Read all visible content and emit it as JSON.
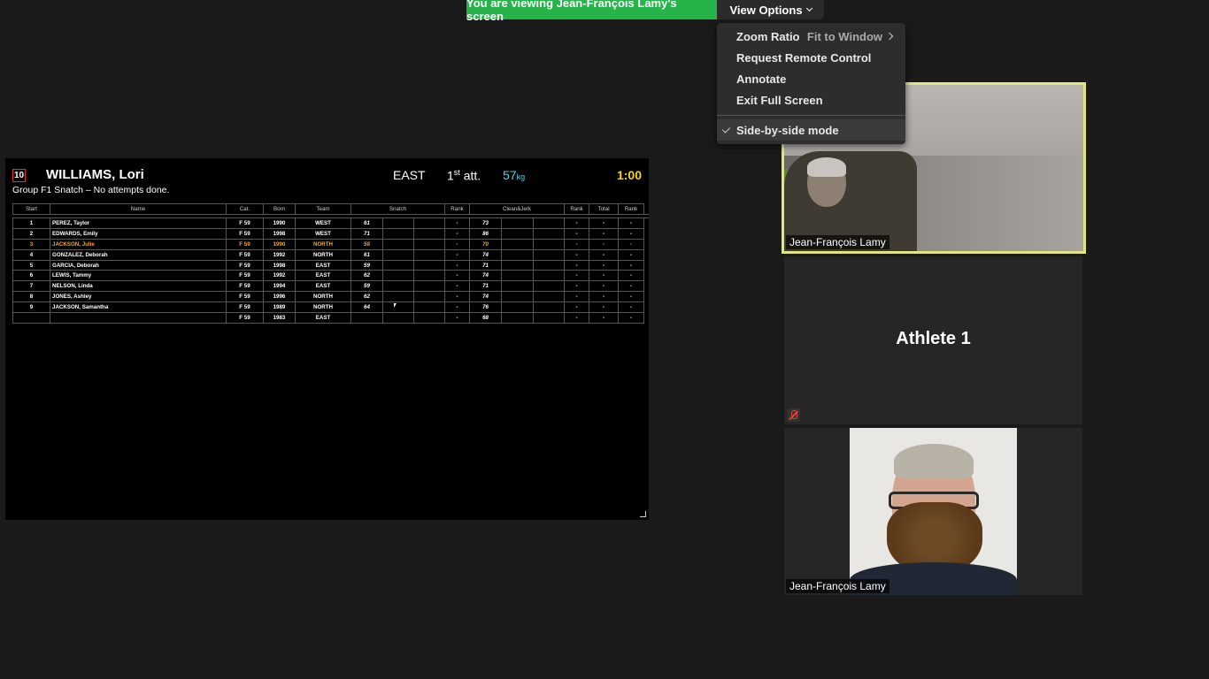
{
  "banner": {
    "share_text": "You are viewing Jean-François Lamy's screen",
    "view_options": "View Options"
  },
  "menu": {
    "zoom_ratio": "Zoom Ratio",
    "zoom_value": "Fit to Window",
    "remote_control": "Request Remote Control",
    "annotate": "Annotate",
    "exit_full_screen": "Exit Full Screen",
    "side_by_side": "Side-by-side mode"
  },
  "scoreboard": {
    "start_number": "10",
    "athlete_name": "WILLIAMS, Lori",
    "team": "EAST",
    "attempt_num": "1",
    "attempt_sup": "st",
    "attempt_suffix": " att.",
    "weight": "57",
    "weight_unit": "kg",
    "clock": "1:00",
    "group_info": "Group F1 Snatch – No attempts done.",
    "headers": {
      "start": "Start",
      "name": "Name",
      "cat": "Cat.",
      "born": "Born",
      "team": "Team",
      "snatch": "Snatch",
      "rank1": "Rank",
      "cj": "Clean&Jerk",
      "rank2": "Rank",
      "total": "Total",
      "rank3": "Rank"
    },
    "rows": [
      {
        "start": "1",
        "name": "PEREZ, Taylor",
        "cat": "F 59",
        "born": "1990",
        "team": "WEST",
        "snatch": "61",
        "cj": "73"
      },
      {
        "start": "2",
        "name": "EDWARDS, Emily",
        "cat": "F 59",
        "born": "1998",
        "team": "WEST",
        "snatch": "71",
        "cj": "86"
      },
      {
        "start": "3",
        "name": "JACKSON, Julie",
        "cat": "F 59",
        "born": "1990",
        "team": "NORTH",
        "snatch": "58",
        "cj": "70"
      },
      {
        "start": "4",
        "name": "GONZALEZ, Deborah",
        "cat": "F 59",
        "born": "1992",
        "team": "NORTH",
        "snatch": "61",
        "cj": "74"
      },
      {
        "start": "5",
        "name": "GARCIA, Deborah",
        "cat": "F 59",
        "born": "1998",
        "team": "EAST",
        "snatch": "59",
        "cj": "71"
      },
      {
        "start": "6",
        "name": "LEWIS, Tammy",
        "cat": "F 59",
        "born": "1992",
        "team": "EAST",
        "snatch": "62",
        "cj": "74"
      },
      {
        "start": "7",
        "name": "NELSON, Linda",
        "cat": "F 59",
        "born": "1994",
        "team": "EAST",
        "snatch": "59",
        "cj": "71"
      },
      {
        "start": "8",
        "name": "JONES, Ashley",
        "cat": "F 59",
        "born": "1996",
        "team": "NORTH",
        "snatch": "62",
        "cj": "74"
      },
      {
        "start": "9",
        "name": "JACKSON, Samantha",
        "cat": "F 59",
        "born": "1989",
        "team": "NORTH",
        "snatch": "64",
        "cj": "76"
      },
      {
        "start": "",
        "name": "",
        "cat": "F 59",
        "born": "1983",
        "team": "EAST",
        "snatch": "",
        "cj": "68"
      }
    ],
    "dash": "-"
  },
  "tiles": {
    "tile1_name": "Jean-François Lamy",
    "tile2_name": "Athlete 1",
    "tile3_name": "Jean-François Lamy"
  },
  "colors": {
    "banner_green": "#25b34a",
    "active_border": "#e0e67a",
    "current_athlete": "#f5a623",
    "clock_yellow": "#f5d90a",
    "weight_cyan": "#4ad3ea"
  }
}
